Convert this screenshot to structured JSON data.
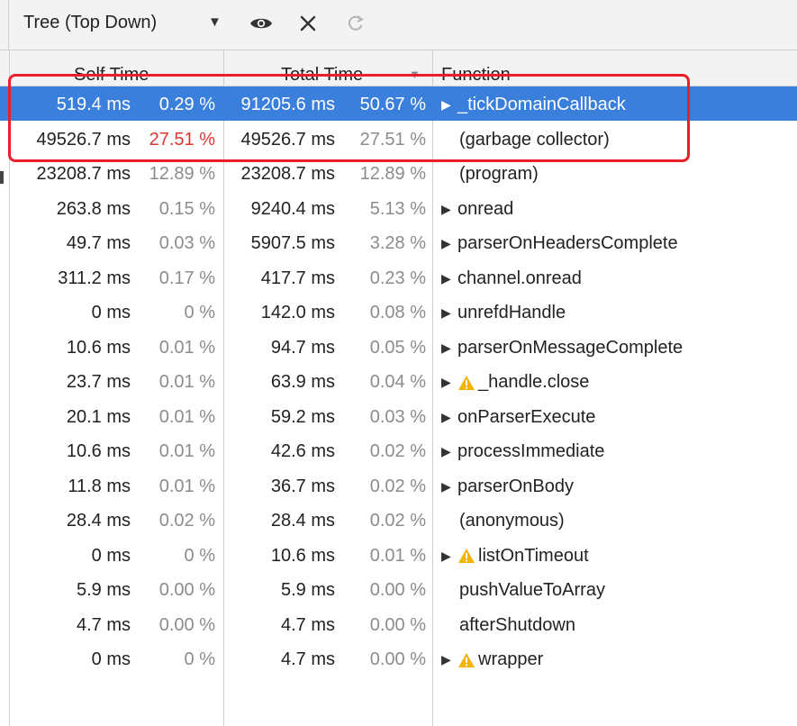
{
  "toolbar": {
    "view_mode": "Tree (Top Down)",
    "icons": [
      "dropdown-arrow-icon",
      "eye-icon",
      "close-icon",
      "reload-icon"
    ]
  },
  "columns": {
    "self_time": "Self Time",
    "total_time": "Total Time",
    "function": "Function",
    "sort_indicator": "▼"
  },
  "rows": [
    {
      "self_ms": "519.4 ms",
      "self_pct": "0.29 %",
      "total_ms": "91205.6 ms",
      "total_pct": "50.67 %",
      "function": "_tickDomainCallback",
      "expandable": true,
      "warning": false,
      "selected": true,
      "highlight_self": false
    },
    {
      "self_ms": "49526.7 ms",
      "self_pct": "27.51 %",
      "total_ms": "49526.7 ms",
      "total_pct": "27.51 %",
      "function": "(garbage collector)",
      "expandable": false,
      "warning": false,
      "selected": false,
      "highlight_self": true
    },
    {
      "self_ms": "23208.7 ms",
      "self_pct": "12.89 %",
      "total_ms": "23208.7 ms",
      "total_pct": "12.89 %",
      "function": "(program)",
      "expandable": false,
      "warning": false,
      "selected": false,
      "highlight_self": false
    },
    {
      "self_ms": "263.8 ms",
      "self_pct": "0.15 %",
      "total_ms": "9240.4 ms",
      "total_pct": "5.13 %",
      "function": "onread",
      "expandable": true,
      "warning": false,
      "selected": false,
      "highlight_self": false
    },
    {
      "self_ms": "49.7 ms",
      "self_pct": "0.03 %",
      "total_ms": "5907.5 ms",
      "total_pct": "3.28 %",
      "function": "parserOnHeadersComplete",
      "expandable": true,
      "warning": false,
      "selected": false,
      "highlight_self": false
    },
    {
      "self_ms": "311.2 ms",
      "self_pct": "0.17 %",
      "total_ms": "417.7 ms",
      "total_pct": "0.23 %",
      "function": "channel.onread",
      "expandable": true,
      "warning": false,
      "selected": false,
      "highlight_self": false
    },
    {
      "self_ms": "0 ms",
      "self_pct": "0 %",
      "total_ms": "142.0 ms",
      "total_pct": "0.08 %",
      "function": "unrefdHandle",
      "expandable": true,
      "warning": false,
      "selected": false,
      "highlight_self": false
    },
    {
      "self_ms": "10.6 ms",
      "self_pct": "0.01 %",
      "total_ms": "94.7 ms",
      "total_pct": "0.05 %",
      "function": "parserOnMessageComplete",
      "expandable": true,
      "warning": false,
      "selected": false,
      "highlight_self": false
    },
    {
      "self_ms": "23.7 ms",
      "self_pct": "0.01 %",
      "total_ms": "63.9 ms",
      "total_pct": "0.04 %",
      "function": "_handle.close",
      "expandable": true,
      "warning": true,
      "selected": false,
      "highlight_self": false
    },
    {
      "self_ms": "20.1 ms",
      "self_pct": "0.01 %",
      "total_ms": "59.2 ms",
      "total_pct": "0.03 %",
      "function": "onParserExecute",
      "expandable": true,
      "warning": false,
      "selected": false,
      "highlight_self": false
    },
    {
      "self_ms": "10.6 ms",
      "self_pct": "0.01 %",
      "total_ms": "42.6 ms",
      "total_pct": "0.02 %",
      "function": "processImmediate",
      "expandable": true,
      "warning": false,
      "selected": false,
      "highlight_self": false
    },
    {
      "self_ms": "11.8 ms",
      "self_pct": "0.01 %",
      "total_ms": "36.7 ms",
      "total_pct": "0.02 %",
      "function": "parserOnBody",
      "expandable": true,
      "warning": false,
      "selected": false,
      "highlight_self": false
    },
    {
      "self_ms": "28.4 ms",
      "self_pct": "0.02 %",
      "total_ms": "28.4 ms",
      "total_pct": "0.02 %",
      "function": "(anonymous)",
      "expandable": false,
      "warning": false,
      "selected": false,
      "highlight_self": false
    },
    {
      "self_ms": "0 ms",
      "self_pct": "0 %",
      "total_ms": "10.6 ms",
      "total_pct": "0.01 %",
      "function": "listOnTimeout",
      "expandable": true,
      "warning": true,
      "selected": false,
      "highlight_self": false
    },
    {
      "self_ms": "5.9 ms",
      "self_pct": "0.00 %",
      "total_ms": "5.9 ms",
      "total_pct": "0.00 %",
      "function": "pushValueToArray",
      "expandable": false,
      "warning": false,
      "selected": false,
      "highlight_self": false
    },
    {
      "self_ms": "4.7 ms",
      "self_pct": "0.00 %",
      "total_ms": "4.7 ms",
      "total_pct": "0.00 %",
      "function": "afterShutdown",
      "expandable": false,
      "warning": false,
      "selected": false,
      "highlight_self": false
    },
    {
      "self_ms": "0 ms",
      "self_pct": "0 %",
      "total_ms": "4.7 ms",
      "total_pct": "0.00 %",
      "function": "wrapper",
      "expandable": true,
      "warning": true,
      "selected": false,
      "highlight_self": false
    }
  ],
  "colors": {
    "selected_row": "#3a7fdc",
    "highlight_border": "#e8202a",
    "percent_highlight": "#e0342f",
    "percent_muted": "#8c8c8c",
    "warning_icon": "#f4b400"
  }
}
